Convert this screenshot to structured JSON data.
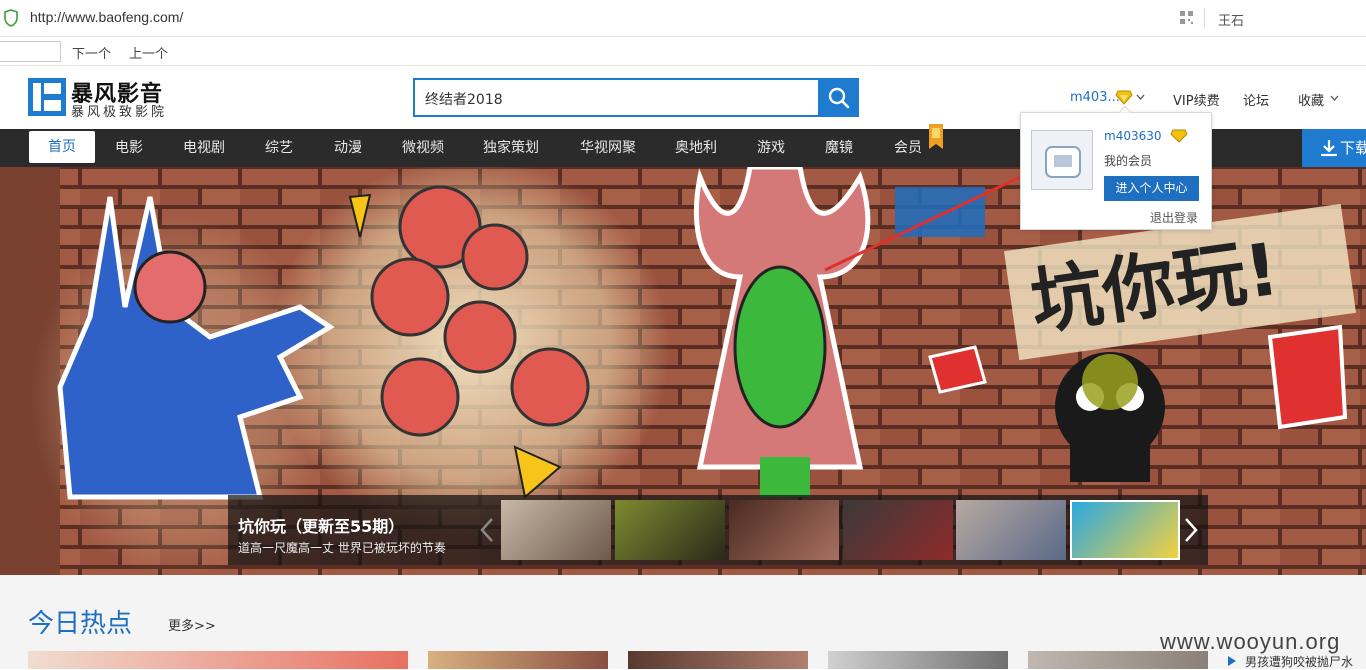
{
  "browser": {
    "url": "http://www.baofeng.com/",
    "user": "王石",
    "find_next": "下一个",
    "find_prev": "上一个"
  },
  "site": {
    "logo_title": "暴风影音",
    "logo_subtitle": "暴风极致影院",
    "search_value": "终结者2018",
    "user_short": "m403...",
    "vip_renew": "VIP续费",
    "forum": "论坛",
    "collect": "收藏"
  },
  "nav": {
    "items": [
      "首页",
      "电影",
      "电视剧",
      "综艺",
      "动漫",
      "微视频",
      "独家策划",
      "华视网聚",
      "奥地利",
      "游戏",
      "魔镜",
      "会员"
    ],
    "download": "下载"
  },
  "banner": {
    "title": "坑你玩（更新至55期）",
    "subtitle": "道高一尺魔高一丈 世界已被玩坏的节奏"
  },
  "popup": {
    "username": "m403630",
    "member": "我的会员",
    "enter_center": "进入个人中心",
    "logout": "退出登录"
  },
  "hot": {
    "title": "今日热点",
    "more": "更多>>",
    "news": "男孩遭狗咬被抛尸水"
  },
  "watermark": "www.wooyun.org",
  "colors": {
    "brand_blue": "#1f7bd0",
    "nav_dark": "#2b2b2b",
    "vip_gold": "#f4c20d"
  }
}
